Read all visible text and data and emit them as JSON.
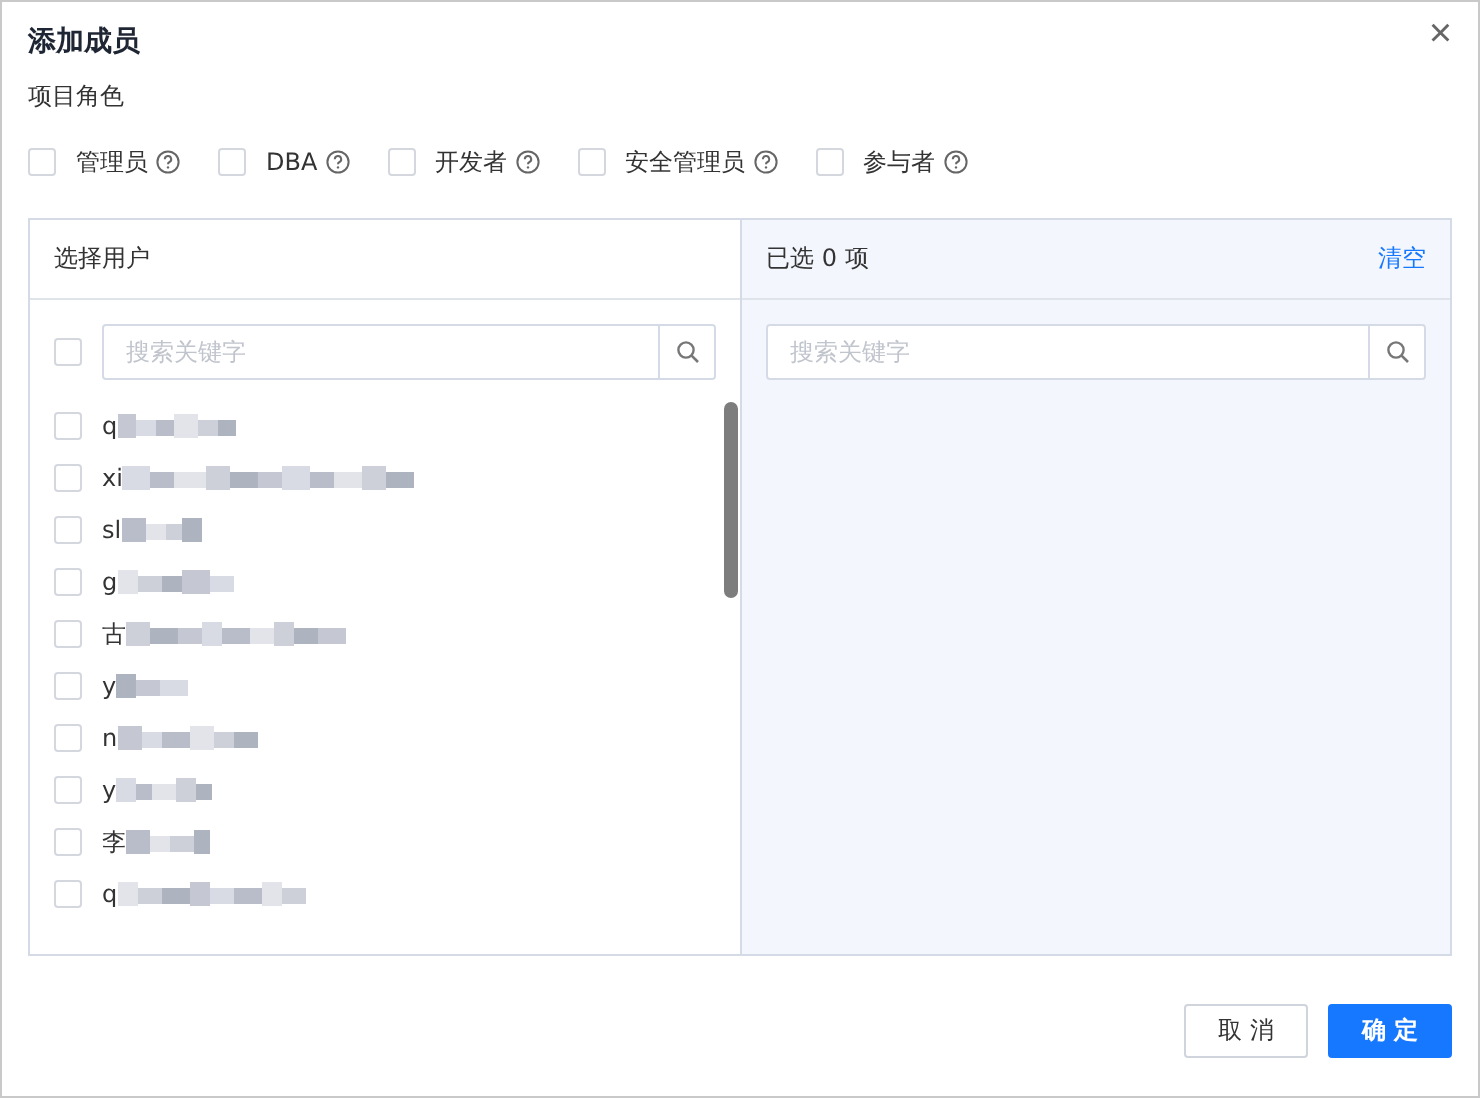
{
  "dialog": {
    "title": "添加成员",
    "close": "×"
  },
  "roles": {
    "label": "项目角色",
    "items": [
      {
        "label": "管理员",
        "checked": false
      },
      {
        "label": "DBA",
        "checked": false
      },
      {
        "label": "开发者",
        "checked": false
      },
      {
        "label": "安全管理员",
        "checked": false
      },
      {
        "label": "参与者",
        "checked": false
      }
    ]
  },
  "source": {
    "title": "选择用户",
    "select_all": {
      "checked": false
    },
    "search": {
      "placeholder": "搜索关键字"
    },
    "users": [
      {
        "name": "q",
        "checked": false
      },
      {
        "name": "xi",
        "checked": false
      },
      {
        "name": "sl",
        "checked": false
      },
      {
        "name": "g",
        "checked": false
      },
      {
        "name": "古",
        "checked": false
      },
      {
        "name": "y",
        "checked": false
      },
      {
        "name": "n",
        "checked": false
      },
      {
        "name": "y",
        "checked": false
      },
      {
        "name": "李",
        "checked": false
      },
      {
        "name": "q",
        "checked": false
      }
    ]
  },
  "target": {
    "title": "已选 0 项",
    "clear": "清空",
    "search": {
      "placeholder": "搜索关键字"
    }
  },
  "buttons": [
    {
      "label": "取 消",
      "kind": "secondary"
    },
    {
      "label": "确 定",
      "kind": "primary"
    }
  ]
}
